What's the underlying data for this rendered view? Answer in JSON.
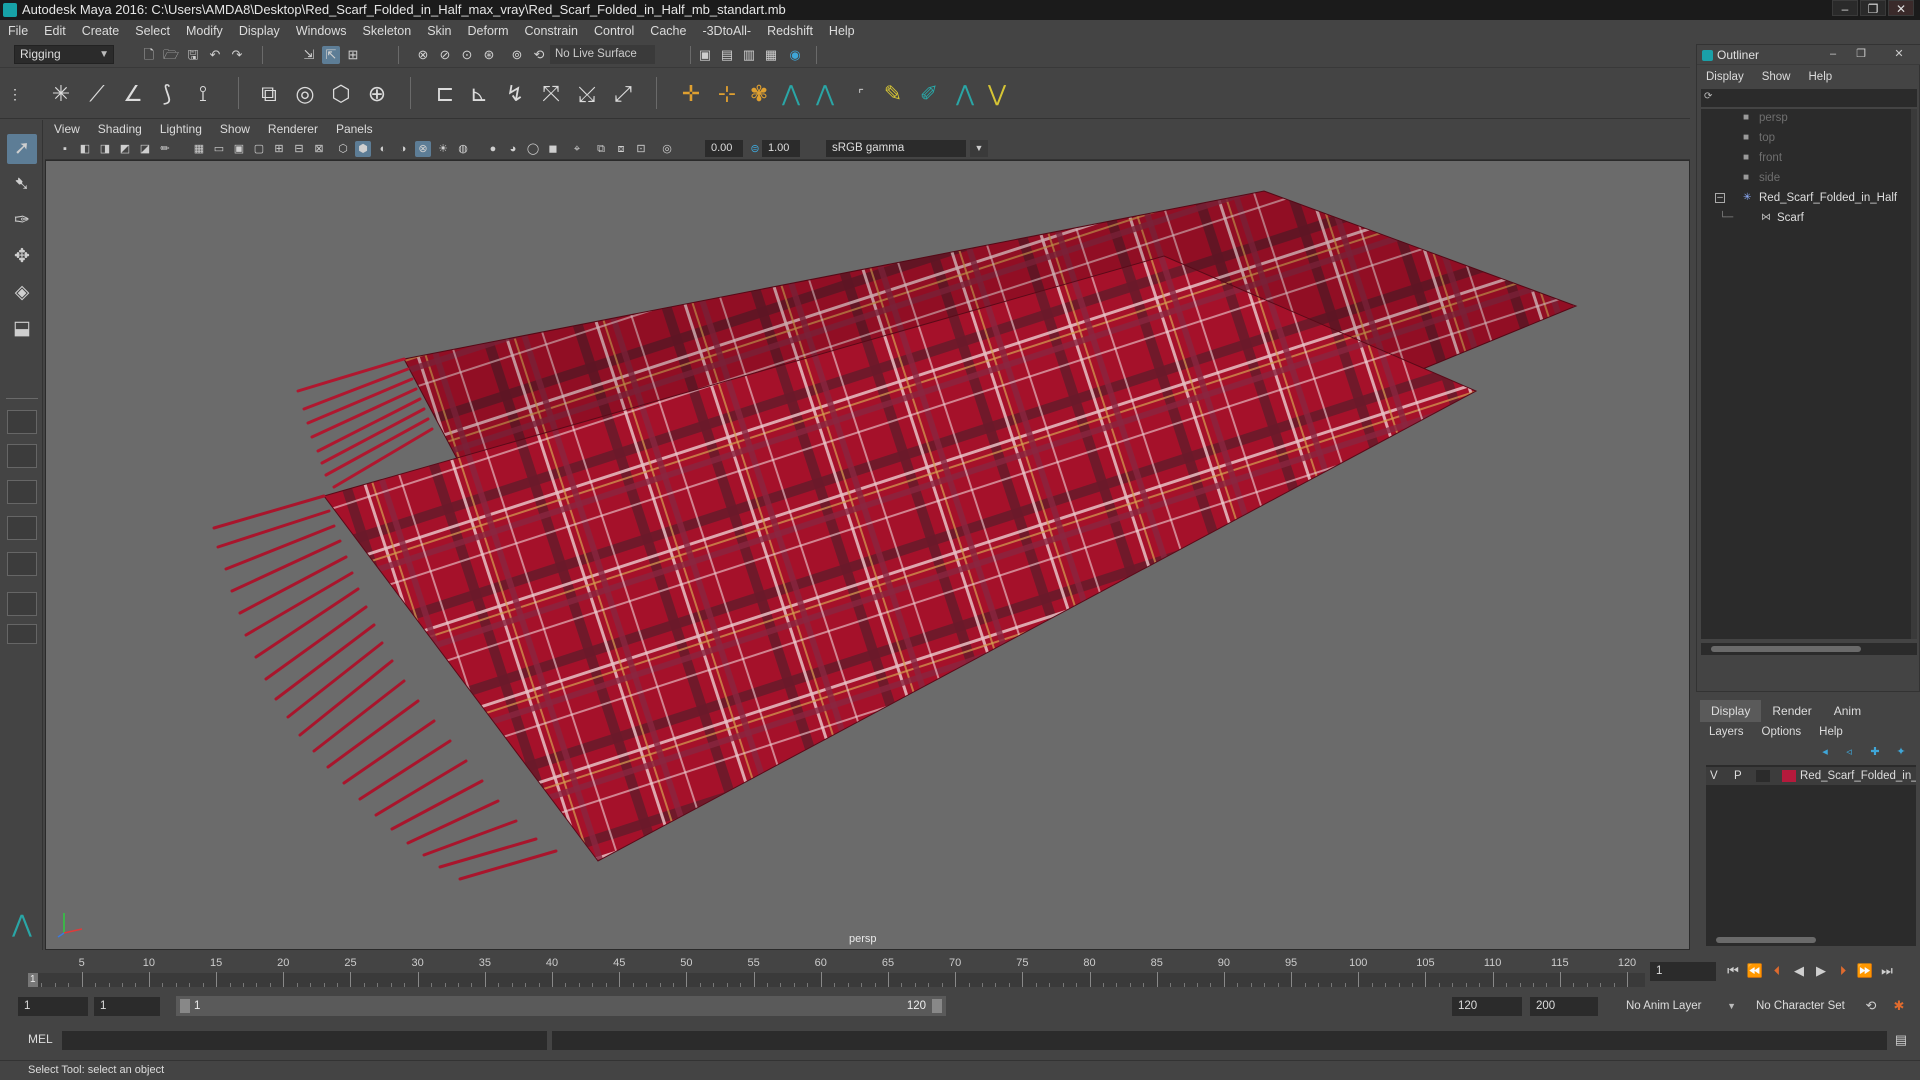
{
  "window": {
    "title": "Autodesk Maya 2016: C:\\Users\\AMDA8\\Desktop\\Red_Scarf_Folded_in_Half_max_vray\\Red_Scarf_Folded_in_Half_mb_standart.mb",
    "controls": [
      "–",
      "❐",
      "✕"
    ]
  },
  "menubar": [
    "File",
    "Edit",
    "Create",
    "Select",
    "Modify",
    "Display",
    "Windows",
    "Skeleton",
    "Skin",
    "Deform",
    "Constrain",
    "Control",
    "Cache",
    "-3DtoAll-",
    "Redshift",
    "Help"
  ],
  "status_line": {
    "mode": "Rigging",
    "live_surface": "No Live Surface"
  },
  "viewport": {
    "menus": [
      "View",
      "Shading",
      "Lighting",
      "Show",
      "Renderer",
      "Panels"
    ],
    "exposure": "0.00",
    "gamma": "1.00",
    "color_space": "sRGB gamma",
    "camera_label": "persp"
  },
  "outliner": {
    "title": "Outliner",
    "menus": [
      "Display",
      "Show",
      "Help"
    ],
    "items": [
      {
        "label": "persp",
        "dim": true,
        "icon": "camera-icon"
      },
      {
        "label": "top",
        "dim": true,
        "icon": "camera-icon"
      },
      {
        "label": "front",
        "dim": true,
        "icon": "camera-icon"
      },
      {
        "label": "side",
        "dim": true,
        "icon": "camera-icon"
      },
      {
        "label": "Red_Scarf_Folded_in_Half",
        "dim": false,
        "icon": "group-icon",
        "expanded": true
      },
      {
        "label": "Scarf",
        "dim": false,
        "icon": "mesh-icon",
        "child": true
      }
    ]
  },
  "layer_editor": {
    "tabs": [
      "Display",
      "Render",
      "Anim"
    ],
    "active_tab": "Display",
    "menus": [
      "Layers",
      "Options",
      "Help"
    ],
    "layer": {
      "visible": "V",
      "playback": "P",
      "name": "Red_Scarf_Folded_in_Half",
      "color": "#b51a3c"
    }
  },
  "time_slider": {
    "ticks": [
      "5",
      "10",
      "15",
      "20",
      "25",
      "30",
      "35",
      "40",
      "45",
      "50",
      "55",
      "60",
      "65",
      "70",
      "75",
      "80",
      "85",
      "90",
      "95",
      "100",
      "105",
      "110",
      "115",
      "120"
    ],
    "start_tick": "1",
    "current_frame": "1",
    "current_frame_field": "1"
  },
  "range_slider": {
    "start": "1",
    "playback_start": "1",
    "range_start": "1",
    "range_end": "120",
    "playback_end": "120",
    "end": "200",
    "anim_layer": "No Anim Layer",
    "character_set": "No Character Set"
  },
  "command_line": {
    "label": "MEL"
  },
  "help_line": "Select Tool: select an object",
  "colors": {
    "scarf_red": "#a5112a",
    "background": "#444444",
    "viewport_bg": "#6b6b6b"
  }
}
